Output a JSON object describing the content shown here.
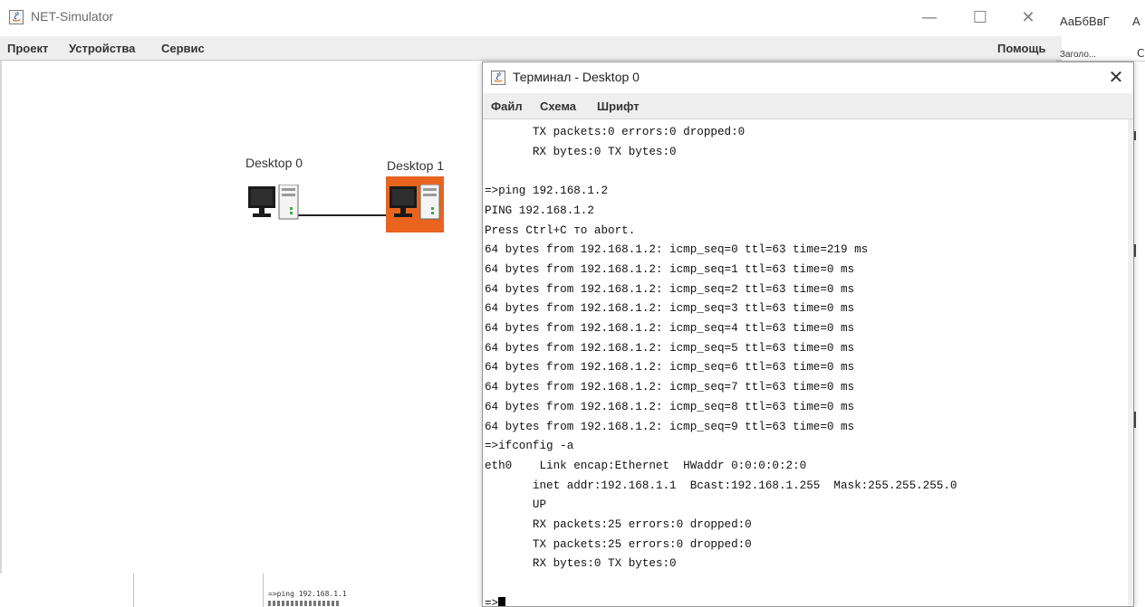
{
  "main_window": {
    "title": "NET-Simulator",
    "icon": "java-app-icon",
    "controls": {
      "minimize": "—",
      "maximize": "☐",
      "close": "✕"
    },
    "menu": {
      "project": "Проект",
      "devices": "Устройства",
      "service": "Сервис",
      "help": "Помощь"
    }
  },
  "canvas": {
    "devices": [
      {
        "label": "Desktop 0",
        "icon": "desktop-computer-icon",
        "selected": false
      },
      {
        "label": "Desktop 1",
        "icon": "desktop-computer-icon",
        "selected": true
      }
    ],
    "highlight_color": "#e8641f"
  },
  "background_app": {
    "style_sample_1": "АаБбВвГ",
    "style_sample_2": "А",
    "heading_label": "Заголо...",
    "style_sample_3": "С",
    "terminal_snippet": "=>ping 192.168.1.1"
  },
  "terminal": {
    "title": "Терминал - Desktop 0",
    "icon": "java-app-icon",
    "close": "✕",
    "menu": {
      "file": "Файл",
      "scheme": "Схема",
      "font": "Шрифт"
    },
    "lines": [
      "       TX packets:0 errors:0 dropped:0",
      "       RX bytes:0 TX bytes:0",
      "",
      "=>ping 192.168.1.2",
      "PING 192.168.1.2",
      "Press Ctrl+C то abort.",
      "64 bytes from 192.168.1.2: icmp_seq=0 ttl=63 time=219 ms",
      "64 bytes from 192.168.1.2: icmp_seq=1 ttl=63 time=0 ms",
      "64 bytes from 192.168.1.2: icmp_seq=2 ttl=63 time=0 ms",
      "64 bytes from 192.168.1.2: icmp_seq=3 ttl=63 time=0 ms",
      "64 bytes from 192.168.1.2: icmp_seq=4 ttl=63 time=0 ms",
      "64 bytes from 192.168.1.2: icmp_seq=5 ttl=63 time=0 ms",
      "64 bytes from 192.168.1.2: icmp_seq=6 ttl=63 time=0 ms",
      "64 bytes from 192.168.1.2: icmp_seq=7 ttl=63 time=0 ms",
      "64 bytes from 192.168.1.2: icmp_seq=8 ttl=63 time=0 ms",
      "64 bytes from 192.168.1.2: icmp_seq=9 ttl=63 time=0 ms",
      "=>ifconfig -a",
      "eth0    Link encap:Ethernet  HWaddr 0:0:0:0:2:0",
      "       inet addr:192.168.1.1  Bcast:192.168.1.255  Mask:255.255.255.0",
      "       UP",
      "       RX packets:25 errors:0 dropped:0",
      "       TX packets:25 errors:0 dropped:0",
      "       RX bytes:0 TX bytes:0",
      "",
      "=>"
    ]
  }
}
